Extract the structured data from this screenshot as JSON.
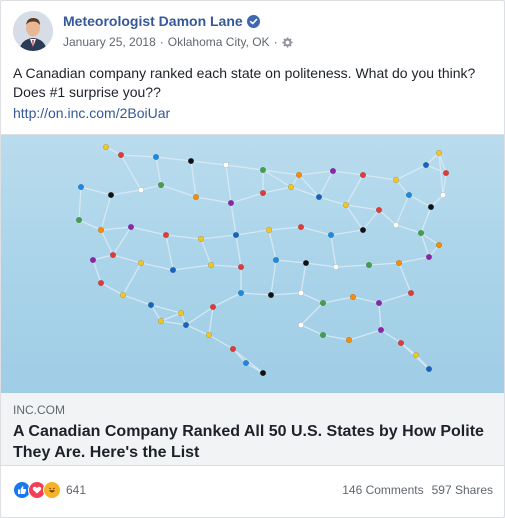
{
  "post": {
    "author": "Meteorologist Damon Lane",
    "date": "January 25, 2018",
    "separator": "·",
    "location": "Oklahoma City, OK",
    "separator2": "·",
    "text": "A Canadian company ranked each state on politeness. What do you think? Does #1 surprise you??",
    "link": "http://on.inc.com/2BoiUar"
  },
  "card": {
    "domain": "INC.COM",
    "title": "A Canadian Company Ranked All 50 U.S. States by How Polite They Are. Here's the List"
  },
  "footer": {
    "reaction_icons": [
      "like-icon",
      "love-icon",
      "haha-icon"
    ],
    "reaction_count": "641",
    "comments": "146 Comments",
    "shares": "597 Shares"
  },
  "colors": {
    "link": "#365899",
    "text": "#1d2129",
    "meta": "#616770",
    "like": "#1877f2",
    "love": "#f33e58",
    "haha": "#f7b125",
    "image_bg": "#a9d3e9"
  }
}
